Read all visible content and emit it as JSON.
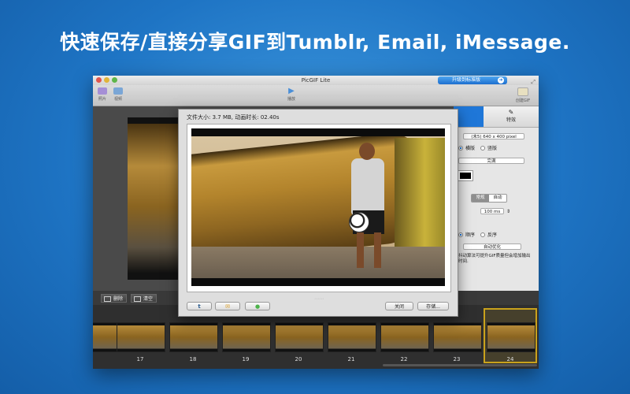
{
  "headline": "快速保存/直接分享GIF到Tumblr, Email, iMessage.",
  "window": {
    "title": "PicGIF Lite",
    "upgrade_label": "升级到标准版"
  },
  "toolbar": {
    "items": [
      {
        "label": "照片",
        "icon": "photo-icon"
      },
      {
        "label": "视频",
        "icon": "video-icon"
      },
      {
        "label": "播放",
        "icon": "play-icon"
      },
      {
        "label": "创建GIF",
        "icon": "create-gif-icon"
      }
    ]
  },
  "right_panel": {
    "tab_effects": "特效",
    "size_select": "(未5) 640 x 400 pixel",
    "orientation": [
      "横版",
      "竖版"
    ],
    "fill_select": "完满",
    "speed_modes": [
      "常规",
      "自动"
    ],
    "delay_value": "100 ms",
    "order": [
      "顺序",
      "反序"
    ],
    "optimize_select": "自动优化",
    "hint": "抖动算法可提升GIF质量但会增加输出时间."
  },
  "bottom_bar": {
    "delete_label": "删除",
    "clear_label": "清空"
  },
  "filmstrip": {
    "frames": [
      "17",
      "18",
      "19",
      "20",
      "21",
      "22",
      "23",
      "24"
    ],
    "selected": "24"
  },
  "dialog": {
    "info": "文件大小: 3.7 MB, 动画时长: 02.40s",
    "close_label": "关闭",
    "save_label": "存储..."
  },
  "colors": {
    "background": "#1e74c4",
    "accent": "#1f77d8",
    "selected_frame": "#c9a21c"
  }
}
